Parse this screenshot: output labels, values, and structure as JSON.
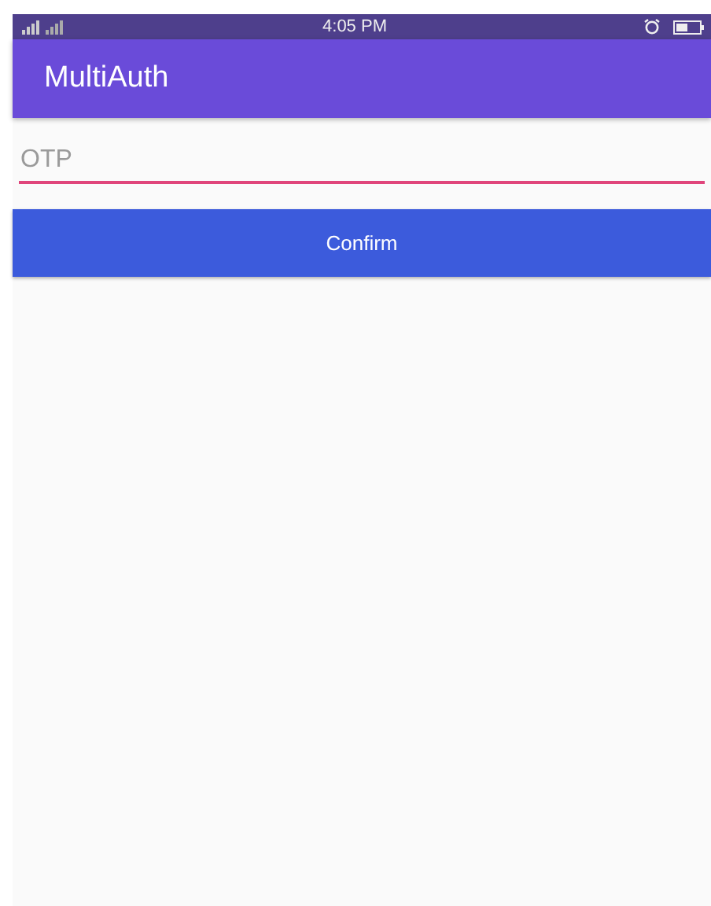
{
  "status_bar": {
    "time": "4:05 PM"
  },
  "app_bar": {
    "title": "MultiAuth"
  },
  "otp_field": {
    "placeholder": "OTP",
    "focused": true
  },
  "confirm_button": {
    "label": "Confirm"
  }
}
